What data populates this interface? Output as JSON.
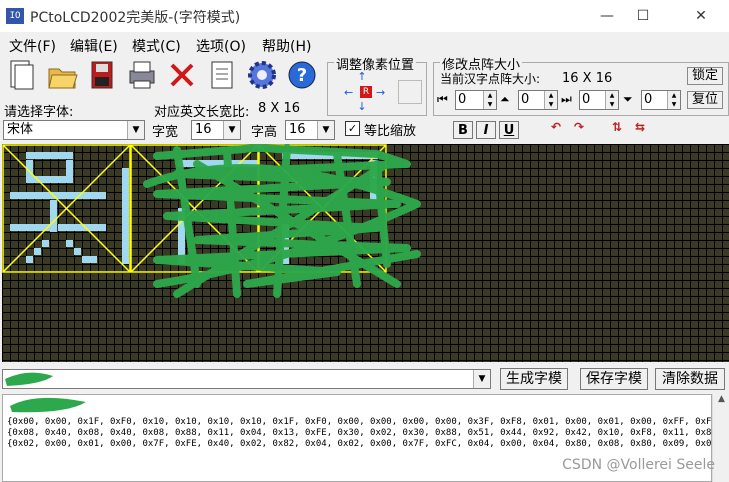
{
  "window": {
    "title": "PCtoLCD2002完美版-(字符模式)",
    "app_icon": "IO"
  },
  "menu": [
    "文件(F)",
    "编辑(E)",
    "模式(C)",
    "选项(O)",
    "帮助(H)"
  ],
  "toolbar_icons": [
    "new-file-icon",
    "open-folder-icon",
    "save-disk-icon",
    "print-icon",
    "delete-x-icon",
    "document-icon",
    "gear-icon",
    "help-icon"
  ],
  "pixel_adjust": {
    "label": "调整像素位置",
    "center": "R"
  },
  "matrix_size": {
    "label": "修改点阵大小",
    "current_label": "当前汉字点阵大小:",
    "current_value": "16 X 16",
    "lock": "锁定",
    "reset": "复位",
    "spin_values": [
      "0",
      "0",
      "0",
      "0"
    ]
  },
  "font": {
    "select_label": "请选择字体:",
    "ratio_label": "对应英文长宽比:",
    "ratio_value": "8 X 16",
    "font_value": "宋体",
    "width_label": "字宽",
    "width_value": "16",
    "height_label": "字高",
    "height_value": "16",
    "proportional_label": "等比缩放",
    "proportional_checked": "✓"
  },
  "format_buttons": [
    "B",
    "I",
    "U"
  ],
  "actions": {
    "generate": "生成字模",
    "save": "保存字模",
    "clear": "清除数据"
  },
  "output_lines": [
    "{0x00, 0x00, 0x1F, 0xF0, 0x10, 0x10, 0x10, 0x10, 0x1F, 0xF0, 0x00, 0x00, 0x00, 0x00, 0x3F, 0xF8, 0x01, 0x00, 0x01, 0x00, 0xFF, 0xFE, 0x02, 0",
    "{0x08, 0x40, 0x08, 0x40, 0x08, 0x88, 0x11, 0x04, 0x13, 0xFE, 0x30, 0x02, 0x30, 0x88, 0x51, 0x44, 0x92, 0x42, 0x10, 0xF8, 0x11, 0x88, 0x12, 0",
    "{0x02, 0x00, 0x01, 0x00, 0x7F, 0xFE, 0x40, 0x02, 0x82, 0x04, 0x02, 0x00, 0x7F, 0xFC, 0x04, 0x00, 0x04, 0x80, 0x08, 0x80, 0x09, 0x00, 0x11, 0"
  ],
  "watermark": "CSDN @Vollerei Seele",
  "colors": {
    "grid_bg": "#3a3a22",
    "lit_pixel": "#9fd8f0",
    "frame": "#ffff00",
    "redaction": "#2ea84c"
  }
}
